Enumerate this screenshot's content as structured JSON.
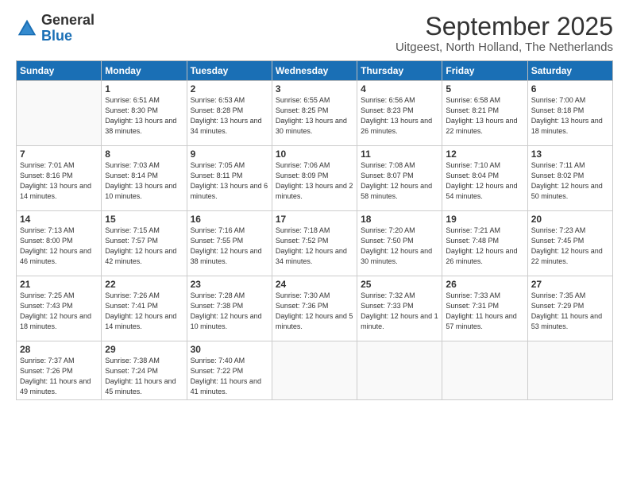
{
  "logo": {
    "general": "General",
    "blue": "Blue"
  },
  "title": "September 2025",
  "subtitle": "Uitgeest, North Holland, The Netherlands",
  "days_of_week": [
    "Sunday",
    "Monday",
    "Tuesday",
    "Wednesday",
    "Thursday",
    "Friday",
    "Saturday"
  ],
  "weeks": [
    [
      {
        "day": "",
        "info": ""
      },
      {
        "day": "1",
        "info": "Sunrise: 6:51 AM\nSunset: 8:30 PM\nDaylight: 13 hours\nand 38 minutes."
      },
      {
        "day": "2",
        "info": "Sunrise: 6:53 AM\nSunset: 8:28 PM\nDaylight: 13 hours\nand 34 minutes."
      },
      {
        "day": "3",
        "info": "Sunrise: 6:55 AM\nSunset: 8:25 PM\nDaylight: 13 hours\nand 30 minutes."
      },
      {
        "day": "4",
        "info": "Sunrise: 6:56 AM\nSunset: 8:23 PM\nDaylight: 13 hours\nand 26 minutes."
      },
      {
        "day": "5",
        "info": "Sunrise: 6:58 AM\nSunset: 8:21 PM\nDaylight: 13 hours\nand 22 minutes."
      },
      {
        "day": "6",
        "info": "Sunrise: 7:00 AM\nSunset: 8:18 PM\nDaylight: 13 hours\nand 18 minutes."
      }
    ],
    [
      {
        "day": "7",
        "info": "Sunrise: 7:01 AM\nSunset: 8:16 PM\nDaylight: 13 hours\nand 14 minutes."
      },
      {
        "day": "8",
        "info": "Sunrise: 7:03 AM\nSunset: 8:14 PM\nDaylight: 13 hours\nand 10 minutes."
      },
      {
        "day": "9",
        "info": "Sunrise: 7:05 AM\nSunset: 8:11 PM\nDaylight: 13 hours\nand 6 minutes."
      },
      {
        "day": "10",
        "info": "Sunrise: 7:06 AM\nSunset: 8:09 PM\nDaylight: 13 hours\nand 2 minutes."
      },
      {
        "day": "11",
        "info": "Sunrise: 7:08 AM\nSunset: 8:07 PM\nDaylight: 12 hours\nand 58 minutes."
      },
      {
        "day": "12",
        "info": "Sunrise: 7:10 AM\nSunset: 8:04 PM\nDaylight: 12 hours\nand 54 minutes."
      },
      {
        "day": "13",
        "info": "Sunrise: 7:11 AM\nSunset: 8:02 PM\nDaylight: 12 hours\nand 50 minutes."
      }
    ],
    [
      {
        "day": "14",
        "info": "Sunrise: 7:13 AM\nSunset: 8:00 PM\nDaylight: 12 hours\nand 46 minutes."
      },
      {
        "day": "15",
        "info": "Sunrise: 7:15 AM\nSunset: 7:57 PM\nDaylight: 12 hours\nand 42 minutes."
      },
      {
        "day": "16",
        "info": "Sunrise: 7:16 AM\nSunset: 7:55 PM\nDaylight: 12 hours\nand 38 minutes."
      },
      {
        "day": "17",
        "info": "Sunrise: 7:18 AM\nSunset: 7:52 PM\nDaylight: 12 hours\nand 34 minutes."
      },
      {
        "day": "18",
        "info": "Sunrise: 7:20 AM\nSunset: 7:50 PM\nDaylight: 12 hours\nand 30 minutes."
      },
      {
        "day": "19",
        "info": "Sunrise: 7:21 AM\nSunset: 7:48 PM\nDaylight: 12 hours\nand 26 minutes."
      },
      {
        "day": "20",
        "info": "Sunrise: 7:23 AM\nSunset: 7:45 PM\nDaylight: 12 hours\nand 22 minutes."
      }
    ],
    [
      {
        "day": "21",
        "info": "Sunrise: 7:25 AM\nSunset: 7:43 PM\nDaylight: 12 hours\nand 18 minutes."
      },
      {
        "day": "22",
        "info": "Sunrise: 7:26 AM\nSunset: 7:41 PM\nDaylight: 12 hours\nand 14 minutes."
      },
      {
        "day": "23",
        "info": "Sunrise: 7:28 AM\nSunset: 7:38 PM\nDaylight: 12 hours\nand 10 minutes."
      },
      {
        "day": "24",
        "info": "Sunrise: 7:30 AM\nSunset: 7:36 PM\nDaylight: 12 hours\nand 5 minutes."
      },
      {
        "day": "25",
        "info": "Sunrise: 7:32 AM\nSunset: 7:33 PM\nDaylight: 12 hours\nand 1 minute."
      },
      {
        "day": "26",
        "info": "Sunrise: 7:33 AM\nSunset: 7:31 PM\nDaylight: 11 hours\nand 57 minutes."
      },
      {
        "day": "27",
        "info": "Sunrise: 7:35 AM\nSunset: 7:29 PM\nDaylight: 11 hours\nand 53 minutes."
      }
    ],
    [
      {
        "day": "28",
        "info": "Sunrise: 7:37 AM\nSunset: 7:26 PM\nDaylight: 11 hours\nand 49 minutes."
      },
      {
        "day": "29",
        "info": "Sunrise: 7:38 AM\nSunset: 7:24 PM\nDaylight: 11 hours\nand 45 minutes."
      },
      {
        "day": "30",
        "info": "Sunrise: 7:40 AM\nSunset: 7:22 PM\nDaylight: 11 hours\nand 41 minutes."
      },
      {
        "day": "",
        "info": ""
      },
      {
        "day": "",
        "info": ""
      },
      {
        "day": "",
        "info": ""
      },
      {
        "day": "",
        "info": ""
      }
    ]
  ]
}
